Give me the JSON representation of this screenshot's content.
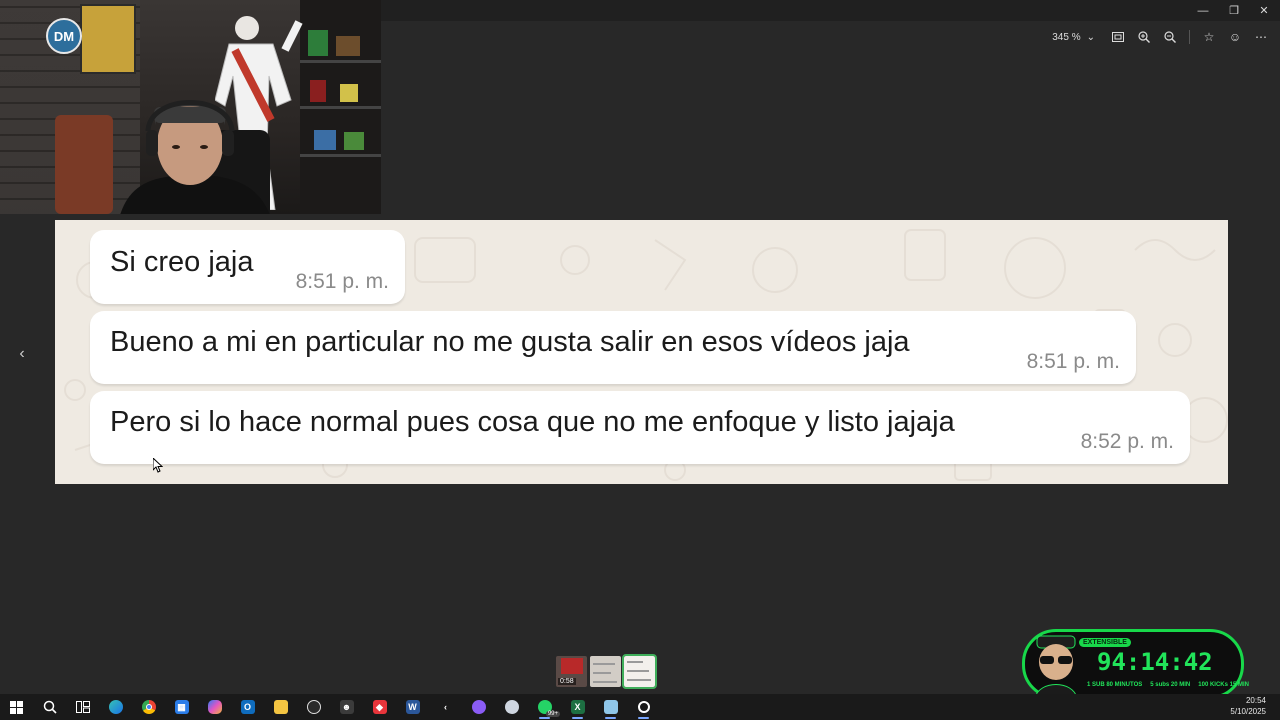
{
  "window": {
    "minimize_glyph": "—",
    "restore_glyph": "❐",
    "close_glyph": "✕"
  },
  "toolbar": {
    "zoom_level": "345 %",
    "zoom_caret": "⌄",
    "icons": [
      "fit-to-window-icon",
      "zoom-in-icon",
      "zoom-out-icon",
      "favorite-star-icon",
      "feedback-smiley-icon",
      "more-options-icon"
    ]
  },
  "webcam": {
    "logo_text": "DM"
  },
  "chat": {
    "messages": [
      {
        "text": "Si creo jaja",
        "time": "8:51 p. m."
      },
      {
        "text": "Bueno a mi en particular no me gusta salir en esos vídeos jaja",
        "time": "8:51 p. m."
      },
      {
        "text": "Pero si lo hace normal pues cosa que no me enfoque y listo jajaja",
        "time": "8:52 p. m."
      }
    ]
  },
  "navigation": {
    "prev_glyph": "‹"
  },
  "thumbnails": {
    "first_label": "0:58"
  },
  "overlay": {
    "badge": "EXTENSIBLE",
    "timer": "94:14:42",
    "stats": [
      "1 SUB 80 MINUTOS",
      "5 subs 20 MIN",
      "100 KICKs 15 MIN"
    ],
    "colors": {
      "accent": "#21e45a"
    }
  },
  "taskbar": {
    "apps": [
      "start-icon",
      "search-icon",
      "task-view-icon",
      "edge-icon",
      "chrome-icon",
      "store-icon",
      "copilot-icon",
      "outlook-icon",
      "file-explorer-icon",
      "obs-icon",
      "cat-app-icon",
      "anydesk-icon",
      "word-icon",
      "kick-icon",
      "discord-icon",
      "app-icon",
      "whatsapp-icon",
      "excel-icon",
      "notepad-icon",
      "app-ring-icon"
    ],
    "whatsapp_badge": "99+",
    "time": "20:54",
    "date": "5/10/2025"
  }
}
